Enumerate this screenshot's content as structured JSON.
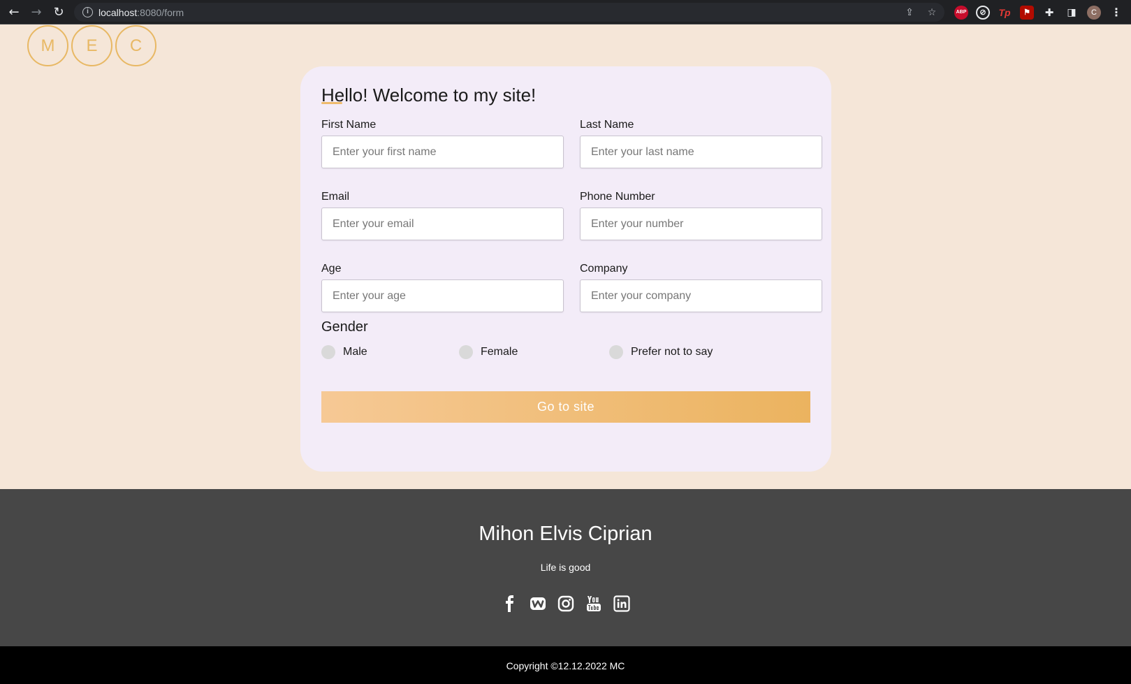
{
  "browser": {
    "url_host": "localhost",
    "url_path": ":8080/form",
    "avatar_letter": "C",
    "ext_abp": "ABP",
    "ext_tp": "Tp"
  },
  "logo": {
    "letters": [
      "M",
      "E",
      "C"
    ]
  },
  "form": {
    "title": "Hello! Welcome to my site!",
    "first_name": {
      "label": "First Name",
      "placeholder": "Enter your first name"
    },
    "last_name": {
      "label": "Last Name",
      "placeholder": "Enter your last name"
    },
    "email": {
      "label": "Email",
      "placeholder": "Enter your email"
    },
    "phone": {
      "label": "Phone Number",
      "placeholder": "Enter your number"
    },
    "age": {
      "label": "Age",
      "placeholder": "Enter your age"
    },
    "company": {
      "label": "Company",
      "placeholder": "Enter your company"
    },
    "gender_title": "Gender",
    "gender_options": [
      "Male",
      "Female",
      "Prefer not to say"
    ],
    "submit_label": "Go to site"
  },
  "footer": {
    "name": "Mihon Elvis Ciprian",
    "tagline": "Life is good",
    "socials": [
      "facebook-icon",
      "webnode-icon",
      "instagram-icon",
      "youtube-icon",
      "linkedin-icon"
    ],
    "copyright": "Copyright ©12.12.2022 MC"
  },
  "colors": {
    "page_background": "#f5e6d8",
    "card_background": "#f3ecf8",
    "accent": "#ebb35f",
    "footer_background": "#474747",
    "copyright_background": "#000000"
  }
}
